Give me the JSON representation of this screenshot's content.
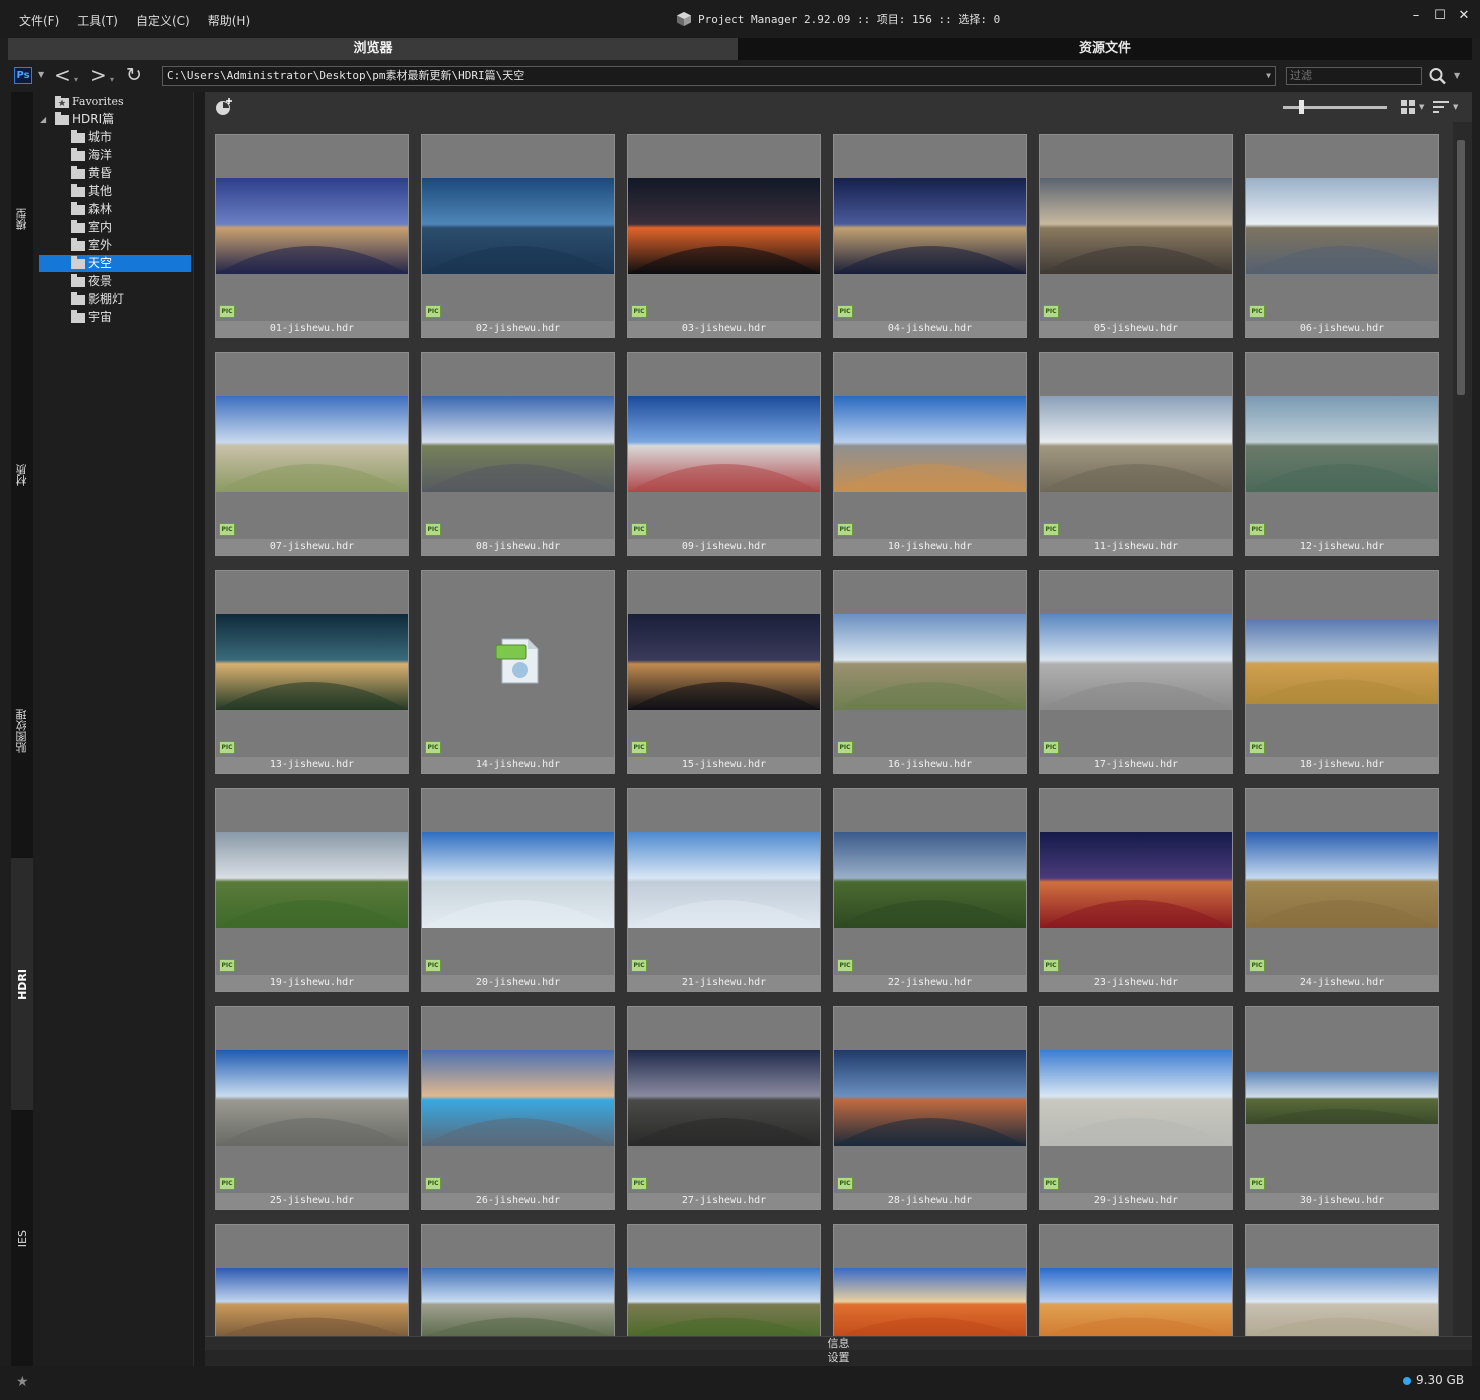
{
  "menu": [
    "文件(F)",
    "工具(T)",
    "自定义(C)",
    "帮助(H)"
  ],
  "app_title": "Project Manager 2.92.09  :: 项目: 156  :: 选择: 0",
  "tabs": {
    "browser": "浏览器",
    "assets": "资源文件"
  },
  "address": "C:\\Users\\Administrator\\Desktop\\pm素材最新更新\\HDRI篇\\天空",
  "filter_placeholder": "过滤",
  "ps_label": "Ps",
  "side_tabs": [
    "模型",
    "材质",
    "贴图纹理",
    "HDRI",
    "IES"
  ],
  "tree": {
    "favorites": "Favorites",
    "root": "HDRI篇",
    "children": [
      "城市",
      "海洋",
      "黄昏",
      "其他",
      "森林",
      "室内",
      "室外",
      "天空",
      "夜景",
      "影棚灯",
      "宇宙"
    ],
    "selected": "天空"
  },
  "files": [
    "01-jishewu.hdr",
    "02-jishewu.hdr",
    "03-jishewu.hdr",
    "04-jishewu.hdr",
    "05-jishewu.hdr",
    "06-jishewu.hdr",
    "07-jishewu.hdr",
    "08-jishewu.hdr",
    "09-jishewu.hdr",
    "10-jishewu.hdr",
    "11-jishewu.hdr",
    "12-jishewu.hdr",
    "13-jishewu.hdr",
    "14-jishewu.hdr",
    "15-jishewu.hdr",
    "16-jishewu.hdr",
    "17-jishewu.hdr",
    "18-jishewu.hdr",
    "19-jishewu.hdr",
    "20-jishewu.hdr",
    "21-jishewu.hdr",
    "22-jishewu.hdr",
    "23-jishewu.hdr",
    "24-jishewu.hdr",
    "25-jishewu.hdr",
    "26-jishewu.hdr",
    "27-jishewu.hdr",
    "28-jishewu.hdr",
    "29-jishewu.hdr",
    "30-jishewu.hdr",
    "",
    "",
    "",
    "",
    "",
    ""
  ],
  "pic_badge": "PIC",
  "info_label": "信息",
  "settings_label": "设置",
  "disk_usage": "9.30 GB",
  "colors": {
    "selected": "#1577d8",
    "disk_dot": "#2ea8f0"
  }
}
